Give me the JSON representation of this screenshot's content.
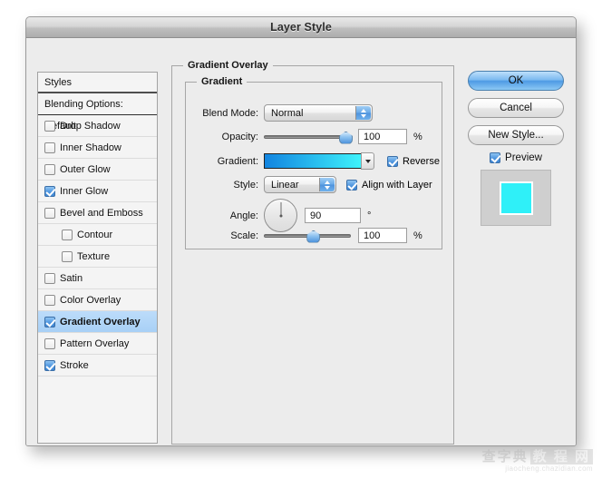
{
  "window": {
    "title": "Layer Style"
  },
  "styles_panel": {
    "header": "Styles",
    "blending_options": "Blending Options: Default",
    "items": [
      {
        "label": "Drop Shadow",
        "checked": false,
        "indent": false,
        "selected": false
      },
      {
        "label": "Inner Shadow",
        "checked": false,
        "indent": false,
        "selected": false
      },
      {
        "label": "Outer Glow",
        "checked": false,
        "indent": false,
        "selected": false
      },
      {
        "label": "Inner Glow",
        "checked": true,
        "indent": false,
        "selected": false
      },
      {
        "label": "Bevel and Emboss",
        "checked": false,
        "indent": false,
        "selected": false
      },
      {
        "label": "Contour",
        "checked": false,
        "indent": true,
        "selected": false
      },
      {
        "label": "Texture",
        "checked": false,
        "indent": true,
        "selected": false
      },
      {
        "label": "Satin",
        "checked": false,
        "indent": false,
        "selected": false
      },
      {
        "label": "Color Overlay",
        "checked": false,
        "indent": false,
        "selected": false
      },
      {
        "label": "Gradient Overlay",
        "checked": true,
        "indent": false,
        "selected": true
      },
      {
        "label": "Pattern Overlay",
        "checked": false,
        "indent": false,
        "selected": false
      },
      {
        "label": "Stroke",
        "checked": true,
        "indent": false,
        "selected": false
      }
    ]
  },
  "main_panel": {
    "title": "Gradient Overlay",
    "group_title": "Gradient",
    "blend_mode": {
      "label": "Blend Mode:",
      "value": "Normal"
    },
    "opacity": {
      "label": "Opacity:",
      "value": "100",
      "unit": "%",
      "percent": 100
    },
    "gradient": {
      "label": "Gradient:",
      "color_start": "#1284e0",
      "color_end": "#3ef2fb",
      "reverse_label": "Reverse",
      "reverse_checked": true
    },
    "style": {
      "label": "Style:",
      "value": "Linear",
      "align_label": "Align with Layer",
      "align_checked": true
    },
    "angle": {
      "label": "Angle:",
      "value": "90",
      "unit": "°"
    },
    "scale": {
      "label": "Scale:",
      "value": "100",
      "unit": "%",
      "percent": 56
    }
  },
  "buttons": {
    "ok": "OK",
    "cancel": "Cancel",
    "new_style": "New Style...",
    "preview_label": "Preview",
    "preview_checked": true,
    "preview_color": "#2ff0f8"
  },
  "watermark": {
    "text_left": "查字典",
    "text_right": "教 程 网",
    "url": "jiaocheng.chazidian.com"
  }
}
